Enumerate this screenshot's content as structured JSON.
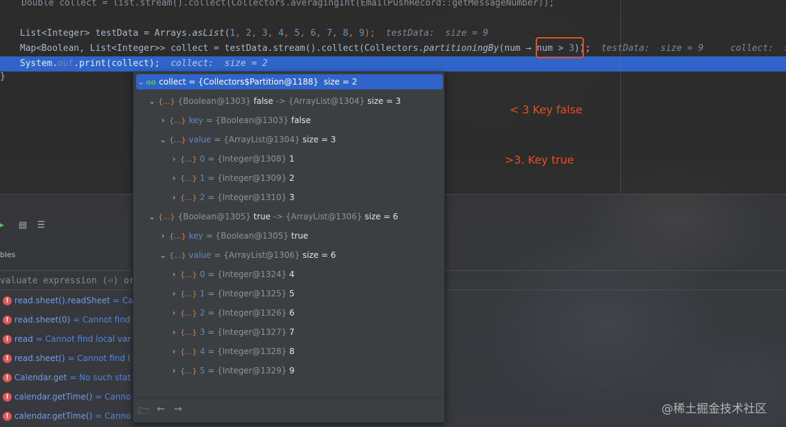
{
  "editor": {
    "line0": "    Double collect = list.stream().collect(Collectors.averagingInt(EmailPushRecord::getMessageNumber));",
    "line2": {
      "type_list": "List",
      "type_int": "<Integer>",
      "name": " testData = Arrays.",
      "method": "asList",
      "args_open": "(",
      "numbers": [
        "1",
        "2",
        "3",
        "4",
        "5",
        "6",
        "7",
        "8",
        "9"
      ],
      "close": ");",
      "hint": "testData:  size = 9"
    },
    "line3": {
      "decl": "Map<Boolean, List<Integer>> collect = testData.stream().collect(Collectors.",
      "method": "partitioningBy",
      "lambda_open": "(num → ",
      "cond": "num > ",
      "cond_num": "3",
      "close": "));",
      "hint1": "testData:  size = 9",
      "hint2": "collect:  s"
    },
    "line4": {
      "prefix": "System.",
      "out": "out",
      "call": ".print(collect);",
      "hint": "collect:  size = 2"
    },
    "closing_brace": "}"
  },
  "popup": {
    "root": {
      "icon": "oo",
      "label": "collect = {Collectors$Partition@1188}",
      "size": "size = 2"
    },
    "rows": [
      {
        "kind": "entry",
        "key_ref": "{Boolean@1303}",
        "key_val": "false",
        "arrow": "->",
        "val_ref": "{ArrayList@1304}",
        "size": "size = 3"
      },
      {
        "kind": "field",
        "name": "key",
        "ref": "{Boolean@1303}",
        "val": "false"
      },
      {
        "kind": "field-list",
        "name": "value",
        "ref": "{ArrayList@1304}",
        "size": "size = 3"
      },
      {
        "kind": "item",
        "idx": "0",
        "ref": "{Integer@1308}",
        "val": "1"
      },
      {
        "kind": "item",
        "idx": "1",
        "ref": "{Integer@1309}",
        "val": "2"
      },
      {
        "kind": "item",
        "idx": "2",
        "ref": "{Integer@1310}",
        "val": "3"
      },
      {
        "kind": "entry",
        "key_ref": "{Boolean@1305}",
        "key_val": "true",
        "arrow": "->",
        "val_ref": "{ArrayList@1306}",
        "size": "size = 6"
      },
      {
        "kind": "field",
        "name": "key",
        "ref": "{Boolean@1305}",
        "val": "true"
      },
      {
        "kind": "field-list",
        "name": "value",
        "ref": "{ArrayList@1306}",
        "size": "size = 6"
      },
      {
        "kind": "item",
        "idx": "0",
        "ref": "{Integer@1324}",
        "val": "4"
      },
      {
        "kind": "item",
        "idx": "1",
        "ref": "{Integer@1325}",
        "val": "5"
      },
      {
        "kind": "item",
        "idx": "2",
        "ref": "{Integer@1326}",
        "val": "6"
      },
      {
        "kind": "item",
        "idx": "3",
        "ref": "{Integer@1327}",
        "val": "7"
      },
      {
        "kind": "item",
        "idx": "4",
        "ref": "{Integer@1328}",
        "val": "8"
      },
      {
        "kind": "item",
        "idx": "5",
        "ref": "{Integer@1329}",
        "val": "9"
      }
    ],
    "obj_glyph": "{...}",
    "eq": "="
  },
  "annotations": {
    "less": "< 3   Key false",
    "greater": ">3. Key true"
  },
  "toolwindow": {
    "tab_label": "bles",
    "eval_placeholder": "valuate expression (⏎) or",
    "variables": [
      {
        "name": "read.sheet().readSheet",
        "msg": "= Ca"
      },
      {
        "name": "read.sheet(0)",
        "msg": "= Cannot find"
      },
      {
        "name": "read",
        "msg": "= Cannot find local var"
      },
      {
        "name": "read.sheet()",
        "msg": "= Cannot find l"
      },
      {
        "name": "Calendar.get",
        "msg": "= No such stat"
      },
      {
        "name": "calendar.getTime()",
        "msg": "= Canno"
      },
      {
        "name": "calendar.getTime()",
        "msg": "= Canno"
      }
    ]
  },
  "watermark": "@稀土掘金技术社区",
  "colors": {
    "accent": "#2f65ca",
    "annotation": "#e6501e",
    "keyword": "#cc7832",
    "number": "#6897bb",
    "error": "#e05555"
  }
}
